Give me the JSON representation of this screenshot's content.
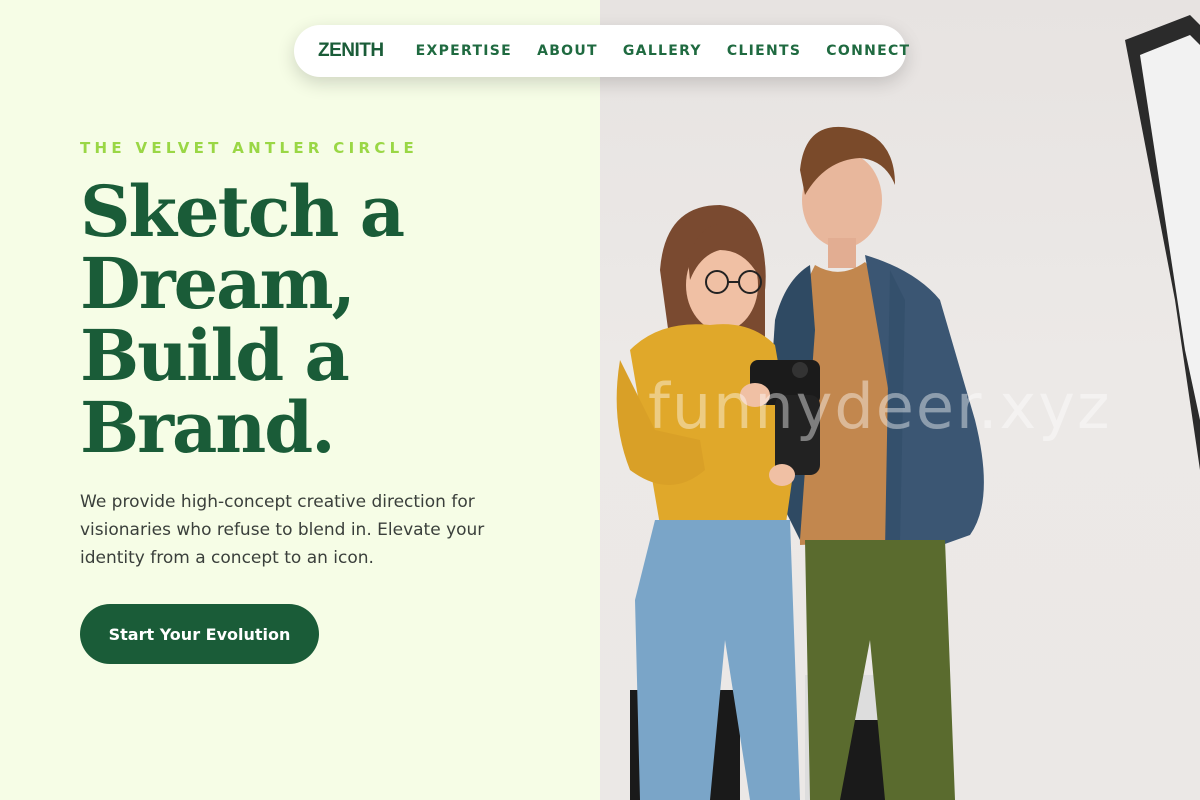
{
  "nav": {
    "logo": "ZENITH",
    "links": [
      "EXPERTISE",
      "ABOUT",
      "GALLERY",
      "CLIENTS",
      "CONNECT"
    ]
  },
  "hero": {
    "eyebrow": "THE VELVET ANTLER CIRCLE",
    "headline_lines": [
      "Sketch a",
      "Dream,",
      "Build a",
      "Brand."
    ],
    "lead": "We provide high-concept creative direction for visionaries who refuse to blend in. Elevate your identity from a concept to an icon.",
    "cta_label": "Start Your Evolution"
  },
  "photo": {
    "description_icon": "photographers-with-camera-image",
    "watermark": "funnydeer.xyz"
  },
  "colors": {
    "brand_green": "#1a5c38",
    "accent_lime": "#9ad745",
    "left_bg": "#f6fde6"
  }
}
